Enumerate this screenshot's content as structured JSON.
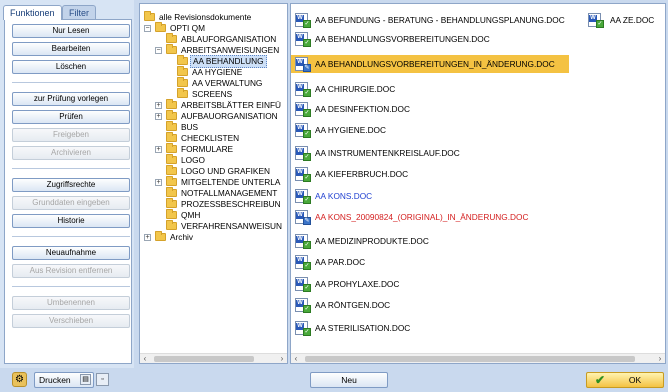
{
  "tabs": [
    {
      "label": "Funktionen"
    },
    {
      "label": "Filter"
    }
  ],
  "actions": {
    "nur_lesen": "Nur Lesen",
    "bearbeiten": "Bearbeiten",
    "loeschen": "Löschen",
    "zur_pruefung": "zur Prüfung vorlegen",
    "pruefen": "Prüfen",
    "freigeben": "Freigeben",
    "archivieren": "Archivieren",
    "zugriffsrechte": "Zugriffsrechte",
    "grunddaten": "Grunddaten eingeben",
    "historie": "Historie",
    "neuaufnahme": "Neuaufnahme",
    "aus_revision": "Aus Revision entfernen",
    "umbenennen": "Umbenennen",
    "verschieben": "Verschieben"
  },
  "tree": {
    "root": "alle Revisionsdokumente",
    "opti": "OPTI QM",
    "ablauf": "ABLAUFORGANISATION",
    "arbeitsanw": "ARBEITSANWEISUNGEN",
    "aa_behandlung": "AA BEHANDLUNG",
    "aa_hygiene": "AA HYGIENE",
    "aa_verwaltung": "AA VERWALTUNG",
    "screens": "SCREENS",
    "arbeitsblaetter": "ARBEITSBLÄTTER EINFÜ",
    "aufbau": "AUFBAUORGANISATION",
    "bus": "BUS",
    "checklisten": "CHECKLISTEN",
    "formulare": "FORMULARE",
    "logo": "LOGO",
    "logo_grafiken": "LOGO UND GRAFIKEN",
    "mitgeltende": "MITGELTENDE UNTERLA",
    "notfall": "NOTFALLMANAGEMENT",
    "prozess": "PROZESSBESCHREIBUN",
    "qmh": "QMH",
    "verfahren": "VERFAHRENSANWEISUN",
    "archiv": "Archiv"
  },
  "files": [
    {
      "name": "AA BEFUNDUNG - BERATUNG - BEHANDLUNGSPLANUNG.DOC",
      "status": "ok",
      "color": "#000000"
    },
    {
      "name": "AA BEHANDLUNGSVORBEREITUNGEN.DOC",
      "status": "ok",
      "color": "#000000"
    },
    {
      "name": "AA BEHANDLUNGSVORBEREITUNGEN_IN_ÄNDERUNG.DOC",
      "status": "edit",
      "color": "#000000"
    },
    {
      "name": "AA CHIRURGIE.DOC",
      "status": "ok",
      "color": "#000000"
    },
    {
      "name": "AA DESINFEKTION.DOC",
      "status": "ok",
      "color": "#000000"
    },
    {
      "name": "AA HYGIENE.DOC",
      "status": "ok",
      "color": "#000000"
    },
    {
      "name": "AA INSTRUMENTENKREISLAUF.DOC",
      "status": "ok",
      "color": "#000000"
    },
    {
      "name": "AA KIEFERBRUCH.DOC",
      "status": "ok",
      "color": "#000000"
    },
    {
      "name": "AA KONS.DOC",
      "status": "ok",
      "color": "#1f3fd0"
    },
    {
      "name": "AA KONS_20090824_(ORIGINAL)_IN_ÄNDERUNG.DOC",
      "status": "edit",
      "color": "#d42020"
    },
    {
      "name": "AA MEDIZINPRODUKTE.DOC",
      "status": "ok",
      "color": "#000000"
    },
    {
      "name": "AA PAR.DOC",
      "status": "ok",
      "color": "#000000"
    },
    {
      "name": "AA PROHYLAXE.DOC",
      "status": "ok",
      "color": "#000000"
    },
    {
      "name": "AA RÖNTGEN.DOC",
      "status": "ok",
      "color": "#000000"
    },
    {
      "name": "AA STERILISATION.DOC",
      "status": "ok",
      "color": "#000000"
    }
  ],
  "second_column_file": {
    "name": "AA ZE.DOC",
    "status": "ok"
  },
  "highlight_color": "#f4c242",
  "bottom": {
    "drucken": "Drucken",
    "neu": "Neu",
    "ok": "OK"
  }
}
